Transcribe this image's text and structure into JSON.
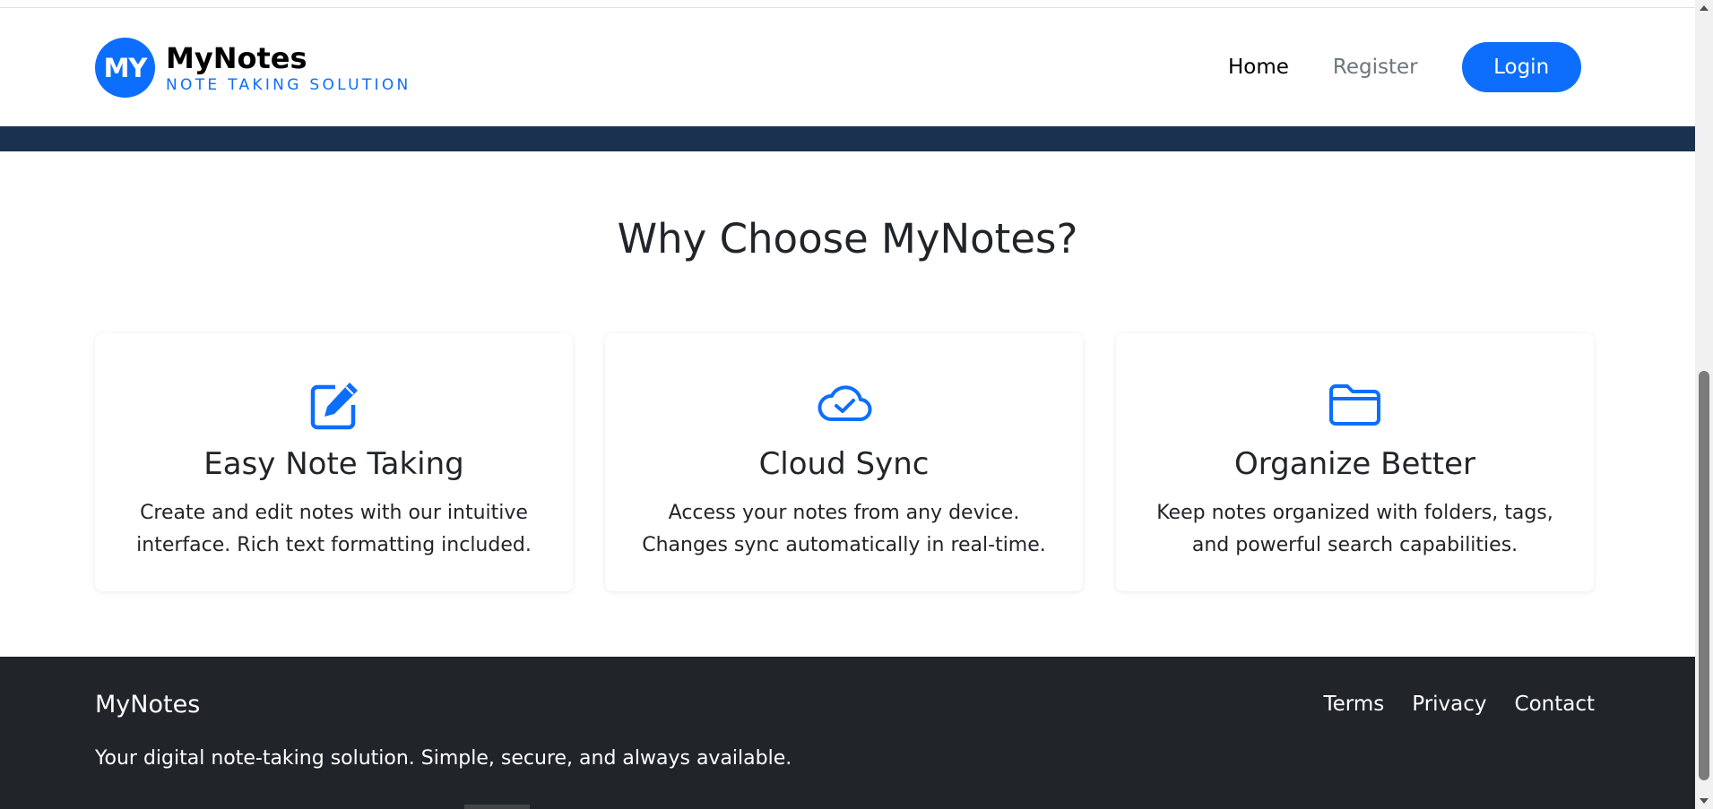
{
  "brand": {
    "badge": "MY",
    "name": "MyNotes",
    "tagline": "NOTE TAKING SOLUTION",
    "color": "#0d6efd"
  },
  "nav": {
    "home": "Home",
    "register": "Register",
    "login": "Login"
  },
  "features": {
    "title": "Why Choose MyNotes?",
    "cards": [
      {
        "icon": "pencil-square-icon",
        "title": "Easy Note Taking",
        "text": "Create and edit notes with our intuitive interface. Rich text formatting included."
      },
      {
        "icon": "cloud-check-icon",
        "title": "Cloud Sync",
        "text": "Access your notes from any device. Changes sync automatically in real-time."
      },
      {
        "icon": "folder-icon",
        "title": "Organize Better",
        "text": "Keep notes organized with folders, tags, and powerful search capabilities."
      }
    ]
  },
  "footer": {
    "brand": "MyNotes",
    "description": "Your digital note-taking solution. Simple, secure, and always available.",
    "links": [
      "Terms",
      "Privacy",
      "Contact"
    ]
  },
  "colors": {
    "accent": "#0d6efd",
    "hero_strip": "#1b3150",
    "footer_bg": "#212529"
  }
}
